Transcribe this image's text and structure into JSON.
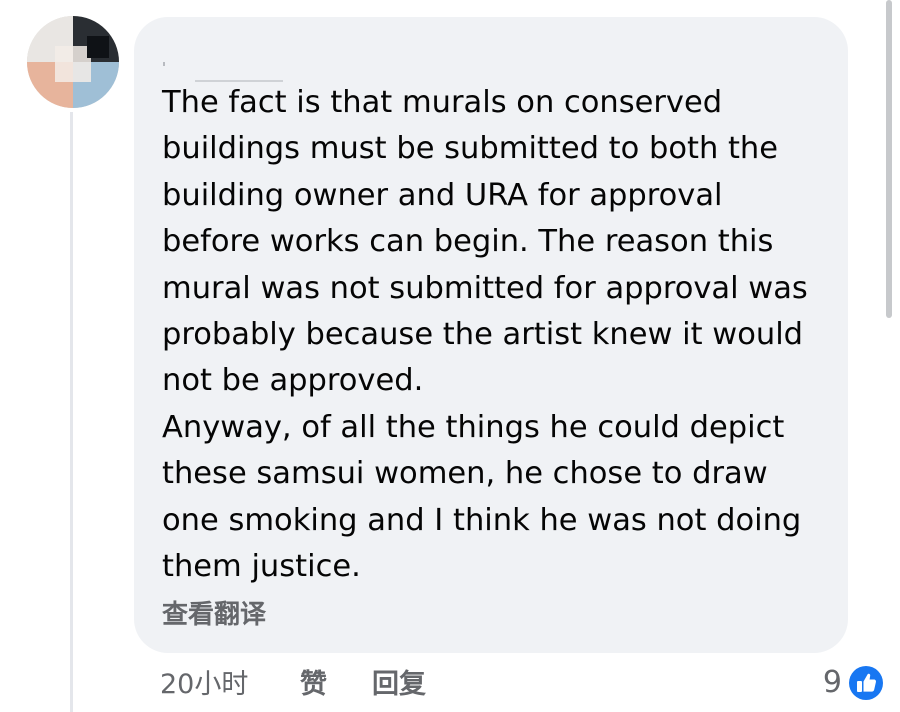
{
  "comment": {
    "text": "The fact is that murals on conserved\nbuildings must be submitted to both the\nbuilding owner and URA for approval\nbefore works can begin. The reason this\nmural was not submitted for approval was\nprobably because the artist knew it would\nnot be approved.\nAnyway, of all the things he could depict\nthese samsui women, he chose to draw\none smoking and I think he was not doing\nthem justice.",
    "translate_label": "查看翻译"
  },
  "footer": {
    "time": "20小时",
    "like_label": "赞",
    "reply_label": "回复",
    "reaction_count": "9",
    "reaction_icon": "like-thumbs-up-icon",
    "reaction_color": "#1877f2"
  },
  "colors": {
    "bubble": "#f0f2f5",
    "text": "#050505",
    "secondary": "#65676b"
  }
}
